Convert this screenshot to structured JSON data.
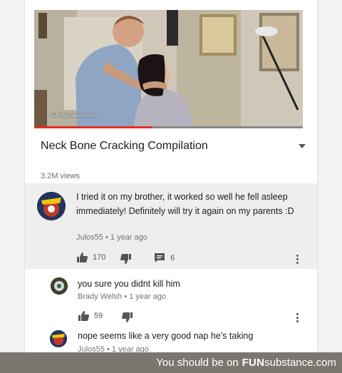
{
  "video": {
    "watermark": "IGPolarSaurusRex",
    "title": "Neck Bone Cracking Compilation",
    "views": "3.2M views",
    "progress": 0.44
  },
  "comments": [
    {
      "text": "I tried it on my brother, it worked so well he fell asleep immediately! Definitely will try it again on my parents :D",
      "author": "Julos55",
      "time": "1 year ago",
      "likes": "170",
      "replies": "6"
    },
    {
      "text": "you sure you didnt kill him",
      "author": "Brady Welsh",
      "time": "1 year ago",
      "likes": "59"
    },
    {
      "text": "nope seems like a very good nap he's taking",
      "author": "Julos55",
      "time": "1 year ago"
    }
  ],
  "banner": {
    "prefix": "You should be on",
    "brand_bold": "FUN",
    "brand_rest": "substance.com"
  },
  "colors": {
    "highlight_bg": "#eeeeee",
    "progress": "#e52d27",
    "banner_bg": "#7c7670"
  },
  "icons": [
    "expand-chevron-icon",
    "thumbs-up-icon",
    "thumbs-down-icon",
    "comment-icon",
    "more-options-icon"
  ]
}
